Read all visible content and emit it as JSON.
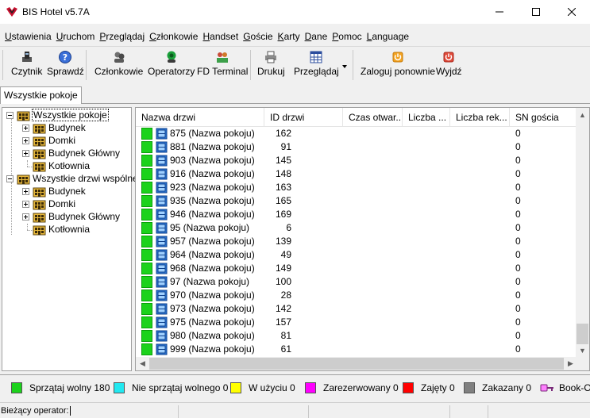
{
  "window": {
    "title": "BIS Hotel v5.7A"
  },
  "menu": [
    "Ustawienia",
    "Uruchom",
    "Przeglądaj",
    "Członkowie",
    "Handset",
    "Goście",
    "Karty",
    "Dane",
    "Pomoc",
    "Language"
  ],
  "toolbar": {
    "reader": "Czytnik",
    "check": "Sprawdź",
    "members": "Członkowie",
    "operators": "Operatorzy",
    "fd_terminal": "FD Terminal",
    "print": "Drukuj",
    "browse": "Przeglądaj",
    "relogin": "Zaloguj ponownie",
    "exit": "Wyjdź"
  },
  "tabs": [
    "Wszystkie pokoje"
  ],
  "tree": {
    "rooms_root": "Wszystkie pokoje",
    "rooms_children": [
      "Budynek",
      "Domki",
      "Budynek Główny",
      "Kotłownia"
    ],
    "doors_root": "Wszystkie drzwi wspólne",
    "doors_children": [
      "Budynek",
      "Domki",
      "Budynek Główny",
      "Kotłownia"
    ]
  },
  "table": {
    "columns": [
      "Nazwa drzwi",
      "ID drzwi",
      "Czas otwar...",
      "Liczba ...",
      "Liczba rek...",
      "SN gościa"
    ],
    "rows": [
      {
        "name": "875 (Nazwa pokoju)",
        "id": "162",
        "sn": "0"
      },
      {
        "name": "881 (Nazwa pokoju)",
        "id": "91",
        "sn": "0"
      },
      {
        "name": "903 (Nazwa pokoju)",
        "id": "145",
        "sn": "0"
      },
      {
        "name": "916 (Nazwa pokoju)",
        "id": "148",
        "sn": "0"
      },
      {
        "name": "923 (Nazwa pokoju)",
        "id": "163",
        "sn": "0"
      },
      {
        "name": "935 (Nazwa pokoju)",
        "id": "165",
        "sn": "0"
      },
      {
        "name": "946 (Nazwa pokoju)",
        "id": "169",
        "sn": "0"
      },
      {
        "name": "95 (Nazwa pokoju)",
        "id": "6",
        "sn": "0"
      },
      {
        "name": "957 (Nazwa pokoju)",
        "id": "139",
        "sn": "0"
      },
      {
        "name": "964 (Nazwa pokoju)",
        "id": "49",
        "sn": "0"
      },
      {
        "name": "968 (Nazwa pokoju)",
        "id": "149",
        "sn": "0"
      },
      {
        "name": "97 (Nazwa pokoju)",
        "id": "100",
        "sn": "0"
      },
      {
        "name": "970 (Nazwa pokoju)",
        "id": "28",
        "sn": "0"
      },
      {
        "name": "973 (Nazwa pokoju)",
        "id": "142",
        "sn": "0"
      },
      {
        "name": "975 (Nazwa pokoju)",
        "id": "157",
        "sn": "0"
      },
      {
        "name": "980 (Nazwa pokoju)",
        "id": "81",
        "sn": "0"
      },
      {
        "name": "999 (Nazwa pokoju)",
        "id": "61",
        "sn": "0"
      }
    ],
    "row_status_color": "#1cd21c"
  },
  "legend": [
    {
      "label": "Sprzątaj wolny 180",
      "color": "#1cd21c"
    },
    {
      "label": "Nie sprzątaj wolnego 0",
      "color": "#22e8f0"
    },
    {
      "label": "W użyciu 0",
      "color": "#ffff00"
    },
    {
      "label": "Zarezerwowany 0",
      "color": "#ff00ff"
    },
    {
      "label": "Zajęty 0",
      "color": "#ff0000"
    },
    {
      "label": "Zakazany 0",
      "color": "#808080"
    },
    {
      "label": "Book-Oc",
      "color": "#ff80ff"
    }
  ],
  "status": {
    "operator_label": "Bieżący operator:"
  }
}
